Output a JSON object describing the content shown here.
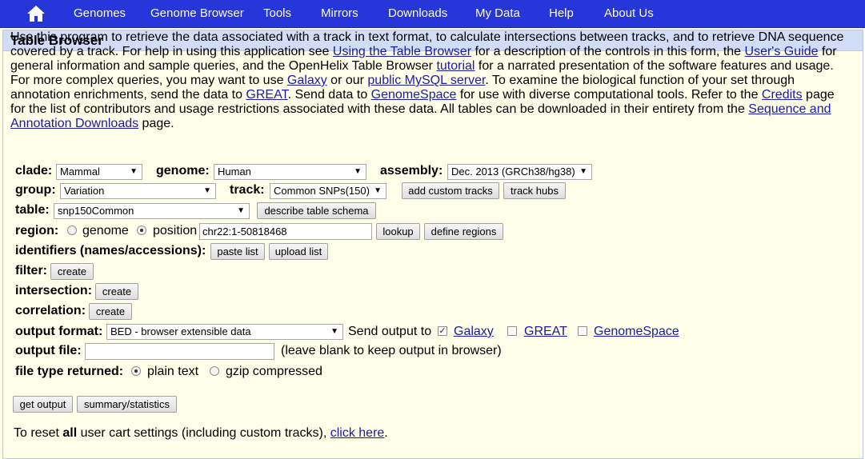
{
  "nav": {
    "home_icon": "home-icon",
    "items": [
      "Genomes",
      "Genome Browser",
      "Tools",
      "Mirrors",
      "Downloads",
      "My Data",
      "Help",
      "About Us"
    ]
  },
  "page": {
    "title": "Table Browser",
    "intro": {
      "t1": "Use this program to retrieve the data associated with a track in text format, to calculate intersections between tracks, and to retrieve DNA sequence covered by a track. For help in using this application see ",
      "l1": "Using the Table Browser",
      "t2": " for a description of the controls in this form, the ",
      "l2": "User's Guide",
      "t3": " for general information and sample queries, and the OpenHelix Table Browser ",
      "l3": "tutorial",
      "t4": " for a narrated presentation of the software features and usage. For more complex queries, you may want to use ",
      "l4": "Galaxy",
      "t5": " or our ",
      "l5": "public MySQL server",
      "t6": ". To examine the biological function of your set through annotation enrichments, send the data to ",
      "l6": "GREAT",
      "t7": ". Send data to ",
      "l7": "GenomeSpace",
      "t8": " for use with diverse computational tools. Refer to the ",
      "l8": "Credits",
      "t9": " page for the list of contributors and usage restrictions associated with these data. All tables can be downloaded in their entirety from the ",
      "l9": "Sequence and Annotation Downloads",
      "t10": " page."
    }
  },
  "form": {
    "clade_label": "clade:",
    "clade_value": "Mammal",
    "genome_label": "genome:",
    "genome_value": "Human",
    "assembly_label": "assembly:",
    "assembly_value": "Dec. 2013 (GRCh38/hg38)",
    "group_label": "group:",
    "group_value": "Variation",
    "track_label": "track:",
    "track_value": "Common SNPs(150)",
    "add_custom_tracks": "add custom tracks",
    "track_hubs": "track hubs",
    "table_label": "table:",
    "table_value": "snp150Common",
    "describe_schema": "describe table schema",
    "region_label": "region:",
    "region_genome": "genome",
    "region_position": "position",
    "position_value": "chr22:1-50818468",
    "lookup": "lookup",
    "define_regions": "define regions",
    "identifiers_label": "identifiers (names/accessions):",
    "paste_list": "paste list",
    "upload_list": "upload list",
    "filter_label": "filter:",
    "intersection_label": "intersection:",
    "correlation_label": "correlation:",
    "create": "create",
    "output_format_label": "output format:",
    "output_format_value": "BED - browser extensible data",
    "send_output_to": "Send output to",
    "galaxy": "Galaxy",
    "great": "GREAT",
    "genomespace": "GenomeSpace",
    "output_file_label": "output file:",
    "output_file_value": "",
    "output_file_hint": "(leave blank to keep output in browser)",
    "file_type_label": "file type returned:",
    "plain_text": "plain text",
    "gzip": "gzip compressed",
    "get_output": "get output",
    "summary_statistics": "summary/statistics"
  },
  "reset": {
    "t1": "To reset ",
    "bold": "all",
    "t2": " user cart settings (including custom tracks), ",
    "link": "click here",
    "t3": "."
  }
}
